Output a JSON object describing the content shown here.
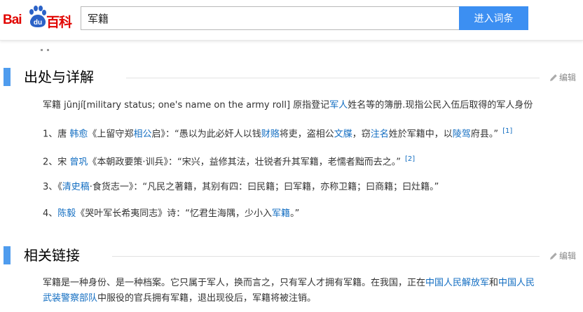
{
  "header": {
    "logo_bai": "Bai",
    "logo_du": "du",
    "logo_baike": "百科",
    "search_value": "军籍",
    "search_button": "进入词条"
  },
  "colors": {
    "brand_red": "#e10602",
    "paw_blue": "#2b62c7",
    "accent_blue": "#3c8ff2",
    "link_blue": "#136ec2"
  },
  "section1": {
    "title": "出处与详解",
    "edit_label": "编辑",
    "definition": {
      "term": "军籍 jūnjí[military status; one's name on the army roll] 原指登记",
      "link1": "军人",
      "rest": "姓名等的簿册.现指公民入伍后取得的军人身份"
    },
    "items": [
      {
        "prefix": "1、唐 ",
        "a1": "韩愈",
        "t1": "《上留守郑",
        "a2": "相公",
        "t2": "启》：“愚以为此必奸人以钱",
        "a3": "财赂",
        "t3": "将吏，盗相公",
        "a4": "文牒",
        "t4": "，窃",
        "a5": "注名",
        "t5": "姓於军籍中，以",
        "a6": "陵驾",
        "t6": "府县。”",
        "sup": "[1]"
      },
      {
        "prefix": "2、宋 ",
        "a1": "曾巩",
        "t1": "《本朝政要策·训兵》：“宋兴，益修其法，壮锐者升其军籍，老懦者黜而去之。”",
        "sup": "[2]"
      },
      {
        "prefix": "3、《",
        "a1": "清史稿",
        "t1": "·食货志一》：“凡民之著籍，其别有四：曰民籍；曰军籍，亦称卫籍；曰商籍；曰灶籍。”"
      },
      {
        "prefix": "4、",
        "a1": "陈毅",
        "t1": "《哭叶军长希夷同志》诗：“忆君生海隅，少小入",
        "a2": "军籍",
        "t2": "。”"
      }
    ]
  },
  "section2": {
    "title": "相关链接",
    "edit_label": "编辑",
    "line1_text": "军籍是一种身份、是一种档案。它只属于军人，换而言之，只有军人才拥有军籍。在我国，正在",
    "line1_link1": "中国人民解放军",
    "line1_and": "和",
    "line1_link2": "中国人民",
    "line2_link": "武装警察部队",
    "line2_text": "中服役的官兵拥有军籍，退出现役后，军籍将被注销。"
  }
}
